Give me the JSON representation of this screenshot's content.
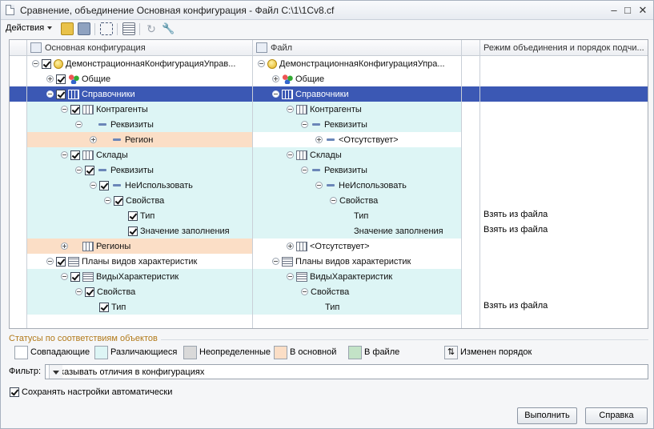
{
  "window": {
    "title": "Сравнение, объединение Основная конфигурация - Файл C:\\1\\1Cv8.cf"
  },
  "toolbar": {
    "actions_label": "Действия"
  },
  "columns": {
    "main": "Основная конфигурация",
    "file": "Файл",
    "mode": "Режим объединения и порядок подчи..."
  },
  "rows": [
    {
      "status": "eq",
      "main": {
        "level": 0,
        "expander": "minus",
        "check": true,
        "icon": "config-icon",
        "label": "ДемонстрационнаяКонфигурацияУправ..."
      },
      "file": {
        "level": 0,
        "expander": "minus",
        "icon": "config-icon",
        "label": "ДемонстрационнаяКонфигурацияУпра..."
      },
      "mode": ""
    },
    {
      "status": "eq",
      "main": {
        "level": 1,
        "expander": "plus",
        "check": true,
        "icon": "common-icon",
        "label": "Общие"
      },
      "file": {
        "level": 1,
        "expander": "plus",
        "icon": "common-icon",
        "label": "Общие"
      },
      "mode": ""
    },
    {
      "status": "sel",
      "main": {
        "level": 1,
        "expander": "minus",
        "check": true,
        "icon": "catalog-icon",
        "label": "Справочники"
      },
      "file": {
        "level": 1,
        "expander": "minus",
        "icon": "catalog-icon",
        "label": "Справочники"
      },
      "mode": ""
    },
    {
      "status": "diff",
      "main": {
        "level": 2,
        "expander": "minus",
        "check": true,
        "icon": "catalog-icon",
        "label": "Контрагенты"
      },
      "file": {
        "level": 2,
        "expander": "minus",
        "icon": "catalog-icon",
        "label": "Контрагенты"
      },
      "mode": ""
    },
    {
      "status": "diff",
      "main": {
        "level": 3,
        "expander": "minus",
        "check": false,
        "icon": "attribute-icon",
        "label": "Реквизиты"
      },
      "file": {
        "level": 3,
        "expander": "minus",
        "icon": "attribute-icon",
        "label": "Реквизиты"
      },
      "mode": ""
    },
    {
      "status": "main",
      "main": {
        "level": 4,
        "expander": "plus",
        "check": false,
        "icon": "attribute-icon",
        "label": "Регион"
      },
      "file": {
        "level": 4,
        "expander": "plus",
        "icon": "attribute-icon",
        "label": "<Отсутствует>"
      },
      "mode": ""
    },
    {
      "status": "diff",
      "main": {
        "level": 2,
        "expander": "minus",
        "check": true,
        "icon": "catalog-icon",
        "label": "Склады"
      },
      "file": {
        "level": 2,
        "expander": "minus",
        "icon": "catalog-icon",
        "label": "Склады"
      },
      "mode": ""
    },
    {
      "status": "diff",
      "main": {
        "level": 3,
        "expander": "minus",
        "check": true,
        "icon": "attribute-icon",
        "label": "Реквизиты"
      },
      "file": {
        "level": 3,
        "expander": "minus",
        "icon": "attribute-icon",
        "label": "Реквизиты"
      },
      "mode": ""
    },
    {
      "status": "diff",
      "main": {
        "level": 4,
        "expander": "minus",
        "check": true,
        "icon": "attribute-icon",
        "label": "НеИспользовать"
      },
      "file": {
        "level": 4,
        "expander": "minus",
        "icon": "attribute-icon",
        "label": "НеИспользовать"
      },
      "mode": ""
    },
    {
      "status": "diff",
      "main": {
        "level": 5,
        "expander": "minus",
        "check": true,
        "icon": "",
        "label": "Свойства"
      },
      "file": {
        "level": 5,
        "expander": "minus",
        "icon": "",
        "label": "Свойства"
      },
      "mode": ""
    },
    {
      "status": "diff",
      "main": {
        "level": 6,
        "expander": "",
        "check": true,
        "icon": "",
        "label": "Тип"
      },
      "file": {
        "level": 6,
        "expander": "",
        "icon": "",
        "label": "Тип"
      },
      "mode": "Взять из файла"
    },
    {
      "status": "diff",
      "main": {
        "level": 6,
        "expander": "",
        "check": true,
        "icon": "",
        "label": "Значение заполнения"
      },
      "file": {
        "level": 6,
        "expander": "",
        "icon": "",
        "label": "Значение заполнения"
      },
      "mode": "Взять из файла"
    },
    {
      "status": "main",
      "main": {
        "level": 2,
        "expander": "plus",
        "check": false,
        "icon": "catalog-icon",
        "label": "Регионы"
      },
      "file": {
        "level": 2,
        "expander": "plus",
        "icon": "catalog-icon",
        "label": "<Отсутствует>"
      },
      "mode": ""
    },
    {
      "status": "eq",
      "main": {
        "level": 1,
        "expander": "minus",
        "check": true,
        "icon": "plan-icon",
        "label": "Планы видов характеристик"
      },
      "file": {
        "level": 1,
        "expander": "minus",
        "icon": "plan-icon",
        "label": "Планы видов характеристик"
      },
      "mode": ""
    },
    {
      "status": "diff",
      "main": {
        "level": 2,
        "expander": "minus",
        "check": true,
        "icon": "plan-icon",
        "label": "ВидыХарактеристик"
      },
      "file": {
        "level": 2,
        "expander": "minus",
        "icon": "plan-icon",
        "label": "ВидыХарактеристик"
      },
      "mode": ""
    },
    {
      "status": "diff",
      "main": {
        "level": 3,
        "expander": "minus",
        "check": true,
        "icon": "",
        "label": "Свойства"
      },
      "file": {
        "level": 3,
        "expander": "minus",
        "icon": "",
        "label": "Свойства"
      },
      "mode": ""
    },
    {
      "status": "diff",
      "main": {
        "level": 4,
        "expander": "",
        "check": true,
        "icon": "",
        "label": "Тип"
      },
      "file": {
        "level": 4,
        "expander": "",
        "icon": "",
        "label": "Тип"
      },
      "mode": "Взять из файла"
    }
  ],
  "legend": {
    "title": "Статусы по соответствиям объектов",
    "items": [
      {
        "label": "Совпадающие",
        "color": "#ffffff"
      },
      {
        "label": "Различающиеся",
        "color": "#ddf5f5"
      },
      {
        "label": "Неопределенные",
        "color": "#d9d9d9"
      },
      {
        "label": "В основной",
        "color": "#fbdec6"
      },
      {
        "label": "В файле",
        "color": "#c3e3c7"
      }
    ],
    "order_label": "Изменен порядок"
  },
  "filter": {
    "label": "Фильтр:",
    "value": "Показывать отличия в конфигурациях"
  },
  "save_settings": {
    "label": "Сохранять настройки автоматически",
    "checked": true
  },
  "buttons": {
    "run": "Выполнить",
    "help": "Справка"
  }
}
